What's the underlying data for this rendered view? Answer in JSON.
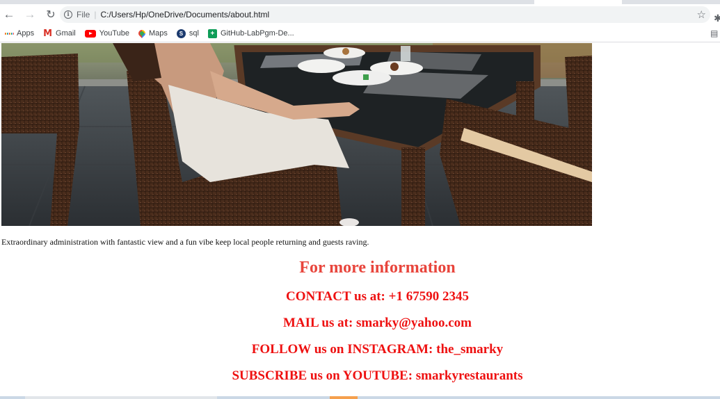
{
  "browser": {
    "url_scheme": "File",
    "url_path": "C:/Users/Hp/OneDrive/Documents/about.html",
    "icons": {
      "back": "back-arrow-icon",
      "forward": "forward-arrow-icon",
      "reload": "reload-icon",
      "info": "info-icon",
      "bookmark_star": "star-icon"
    }
  },
  "bookmarks": [
    {
      "label": "Apps",
      "icon": "apps-grid-icon"
    },
    {
      "label": "Gmail",
      "icon": "gmail-icon"
    },
    {
      "label": "YouTube",
      "icon": "youtube-icon"
    },
    {
      "label": "Maps",
      "icon": "maps-pin-icon"
    },
    {
      "label": "sql",
      "icon": "sql-icon"
    },
    {
      "label": "GitHub-LabPgm-De...",
      "icon": "sheets-plus-icon"
    }
  ],
  "page": {
    "caption": "Extraordinary administration with fantastic view and a fun vibe keep local people returning and guests raving.",
    "info_title": "For more information",
    "contact": "CONTACT us at: +1 67590 2345",
    "mail": "MAIL us at: smarky@yahoo.com",
    "instagram": "FOLLOW us on INSTAGRAM: the_smarky",
    "youtube": "SUBSCRIBE us on YOUTUBE: smarkyrestaurants"
  },
  "colors": {
    "heading": "#e8453c",
    "info_text": "#ee1111"
  }
}
